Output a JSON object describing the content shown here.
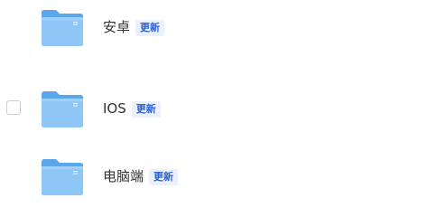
{
  "files": [
    {
      "name": "安卓",
      "badge": "更新",
      "icon": "folder-icon",
      "checkbox_visible": false
    },
    {
      "name": "IOS",
      "badge": "更新",
      "icon": "folder-icon",
      "checkbox_visible": true
    },
    {
      "name": "电脑端",
      "badge": "更新",
      "icon": "folder-icon",
      "checkbox_visible": false
    }
  ],
  "colors": {
    "folder_back": "#5aa7ec",
    "folder_front": "#8ec6f8",
    "badge_text": "#2e5fd3",
    "badge_bg": "#eaf1fd",
    "text": "#333333"
  }
}
